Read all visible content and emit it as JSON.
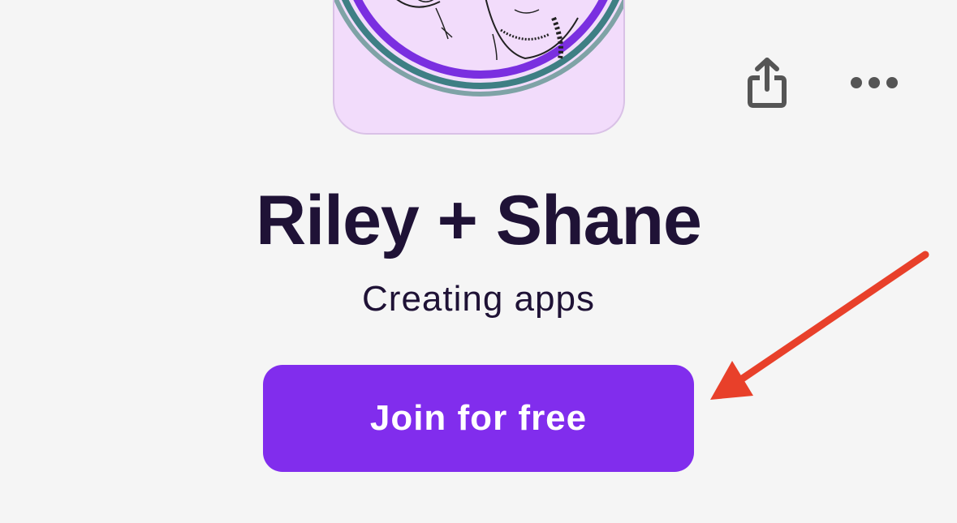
{
  "profile": {
    "name": "Riley + Shane",
    "tagline": "Creating apps"
  },
  "actions": {
    "join_label": "Join for free",
    "share_icon": "share-icon",
    "more_icon": "more-horizontal-icon"
  },
  "colors": {
    "background": "#f5f5f5",
    "accent": "#812ded",
    "title_text": "#1f1236",
    "avatar_bg": "#f2dcfb",
    "annotation_arrow": "#e8402a"
  }
}
